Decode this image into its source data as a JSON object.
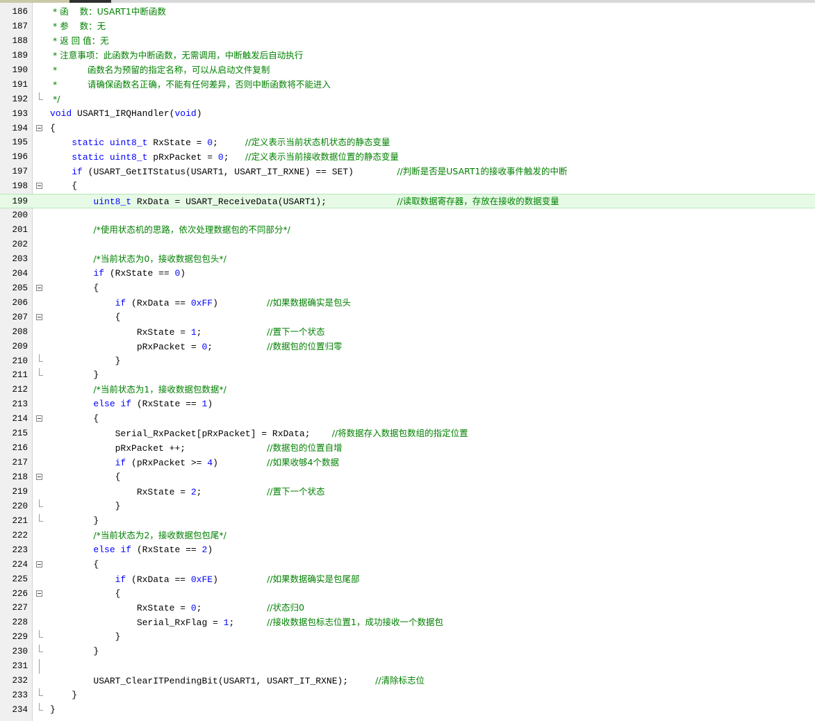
{
  "editor": {
    "lines": [
      {
        "n": "186",
        "code": "",
        "comment": " * 函    数：USART1中断函数"
      },
      {
        "n": "187",
        "code": "",
        "comment": " * 参    数：无"
      },
      {
        "n": "188",
        "code": "",
        "comment": " * 返 回 值：无"
      },
      {
        "n": "189",
        "code": "",
        "comment": " * 注意事项：此函数为中断函数，无需调用，中断触发后自动执行"
      },
      {
        "n": "190",
        "code": "",
        "comment": " *           函数名为预留的指定名称，可以从启动文件复制"
      },
      {
        "n": "191",
        "code": "",
        "comment": " *           请确保函数名正确，不能有任何差异，否则中断函数将不能进入"
      },
      {
        "n": "192",
        "code": "",
        "comment": " */"
      },
      {
        "n": "193",
        "code": "void USART1_IRQHandler(void)",
        "comment": ""
      },
      {
        "n": "194",
        "code": "{",
        "comment": ""
      },
      {
        "n": "195",
        "code": "    static uint8_t RxState = 0;     ",
        "comment": "//定义表示当前状态机状态的静态变量"
      },
      {
        "n": "196",
        "code": "    static uint8_t pRxPacket = 0;   ",
        "comment": "//定义表示当前接收数据位置的静态变量"
      },
      {
        "n": "197",
        "code": "    if (USART_GetITStatus(USART1, USART_IT_RXNE) == SET)        ",
        "comment": "//判断是否是USART1的接收事件触发的中断"
      },
      {
        "n": "198",
        "code": "    {",
        "comment": ""
      },
      {
        "n": "199",
        "code": "        uint8_t RxData = USART_ReceiveData(USART1);             ",
        "comment": "//读取数据寄存器，存放在接收的数据变量"
      },
      {
        "n": "200",
        "code": "",
        "comment": ""
      },
      {
        "n": "201",
        "code": "        ",
        "comment": "/*使用状态机的思路，依次处理数据包的不同部分*/"
      },
      {
        "n": "202",
        "code": "",
        "comment": ""
      },
      {
        "n": "203",
        "code": "        ",
        "comment": "/*当前状态为0，接收数据包包头*/"
      },
      {
        "n": "204",
        "code": "        if (RxState == 0)",
        "comment": ""
      },
      {
        "n": "205",
        "code": "        {",
        "comment": ""
      },
      {
        "n": "206",
        "code": "            if (RxData == 0xFF)         ",
        "comment": "//如果数据确实是包头"
      },
      {
        "n": "207",
        "code": "            {",
        "comment": ""
      },
      {
        "n": "208",
        "code": "                RxState = 1;            ",
        "comment": "//置下一个状态"
      },
      {
        "n": "209",
        "code": "                pRxPacket = 0;          ",
        "comment": "//数据包的位置归零"
      },
      {
        "n": "210",
        "code": "            }",
        "comment": ""
      },
      {
        "n": "211",
        "code": "        }",
        "comment": ""
      },
      {
        "n": "212",
        "code": "        ",
        "comment": "/*当前状态为1，接收数据包数据*/"
      },
      {
        "n": "213",
        "code": "        else if (RxState == 1)",
        "comment": ""
      },
      {
        "n": "214",
        "code": "        {",
        "comment": ""
      },
      {
        "n": "215",
        "code": "            Serial_RxPacket[pRxPacket] = RxData;    ",
        "comment": "//将数据存入数据包数组的指定位置"
      },
      {
        "n": "216",
        "code": "            pRxPacket ++;               ",
        "comment": "//数据包的位置自增"
      },
      {
        "n": "217",
        "code": "            if (pRxPacket >= 4)         ",
        "comment": "//如果收够4个数据"
      },
      {
        "n": "218",
        "code": "            {",
        "comment": ""
      },
      {
        "n": "219",
        "code": "                RxState = 2;            ",
        "comment": "//置下一个状态"
      },
      {
        "n": "220",
        "code": "            }",
        "comment": ""
      },
      {
        "n": "221",
        "code": "        }",
        "comment": ""
      },
      {
        "n": "222",
        "code": "        ",
        "comment": "/*当前状态为2，接收数据包包尾*/"
      },
      {
        "n": "223",
        "code": "        else if (RxState == 2)",
        "comment": ""
      },
      {
        "n": "224",
        "code": "        {",
        "comment": ""
      },
      {
        "n": "225",
        "code": "            if (RxData == 0xFE)         ",
        "comment": "//如果数据确实是包尾部"
      },
      {
        "n": "226",
        "code": "            {",
        "comment": ""
      },
      {
        "n": "227",
        "code": "                RxState = 0;            ",
        "comment": "//状态归0"
      },
      {
        "n": "228",
        "code": "                Serial_RxFlag = 1;      ",
        "comment": "//接收数据包标志位置1，成功接收一个数据包"
      },
      {
        "n": "229",
        "code": "            }",
        "comment": ""
      },
      {
        "n": "230",
        "code": "        }",
        "comment": ""
      },
      {
        "n": "231",
        "code": "",
        "comment": ""
      },
      {
        "n": "232",
        "code": "        USART_ClearITPendingBit(USART1, USART_IT_RXNE);     ",
        "comment": "//清除标志位"
      },
      {
        "n": "233",
        "code": "    }",
        "comment": ""
      },
      {
        "n": "234",
        "code": "}",
        "comment": ""
      }
    ]
  }
}
